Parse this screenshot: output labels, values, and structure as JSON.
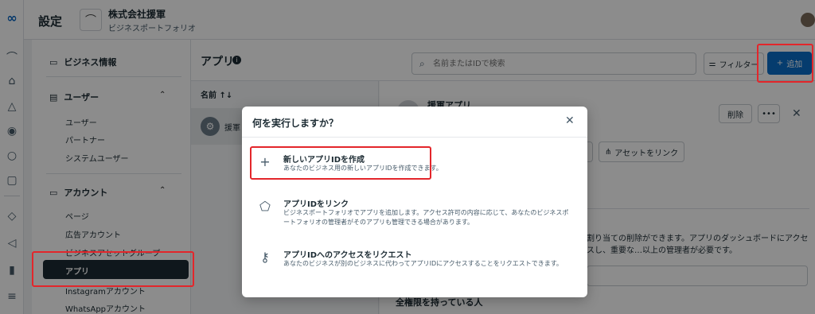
{
  "topbar": {
    "title": "設定",
    "business_name": "株式会社援軍",
    "business_sub": "ビジネスポートフォリオ"
  },
  "sidebar": {
    "business_info": "ビジネス情報",
    "users_header": "ユーザー",
    "user_items": [
      "ユーザー",
      "パートナー",
      "システムユーザー"
    ],
    "accounts_header": "アカウント",
    "account_items": [
      "ページ",
      "広告アカウント",
      "ビジネスアセットグループ",
      "アプリ",
      "Instagramアカウント",
      "WhatsAppアカウント"
    ],
    "active_item": "アプリ"
  },
  "main": {
    "title": "アプリ",
    "search_placeholder": "名前またはIDで検索",
    "filter_label": "フィルター",
    "add_label": "追加",
    "list_header": "名前 ↑↓",
    "list_row_name": "援軍",
    "detail_app_name": "援軍アプリ",
    "delete_label": "削除",
    "more_label": "•••",
    "link_asset_label": "アセットをリンク",
    "detail_desc": "割り当ての削除ができます。アプリのダッシュボードにアクセスし、重要な…以上の管理者が必要です。",
    "full_perm_label": "全権限を持っている人"
  },
  "modal": {
    "title": "何を実行しますか？",
    "options": [
      {
        "title": "新しいアプリIDを作成",
        "desc": "あなたのビジネス用の新しいアプリIDを作成できます。"
      },
      {
        "title": "アプリIDをリンク",
        "desc": "ビジネスポートフォリオでアプリを追加します。アクセス許可の内容に応じて、あなたのビジネスポートフォリオの管理者がそのアプリも管理できる場合があります。"
      },
      {
        "title": "アプリIDへのアクセスをリクエスト",
        "desc": "あなたのビジネスが別のビジネスに代わってアプリIDにアクセスすることをリクエストできます。"
      }
    ]
  },
  "colors": {
    "accent": "#0a6ec8",
    "highlight": "#e3262b",
    "active_bg": "#1c2b33"
  }
}
